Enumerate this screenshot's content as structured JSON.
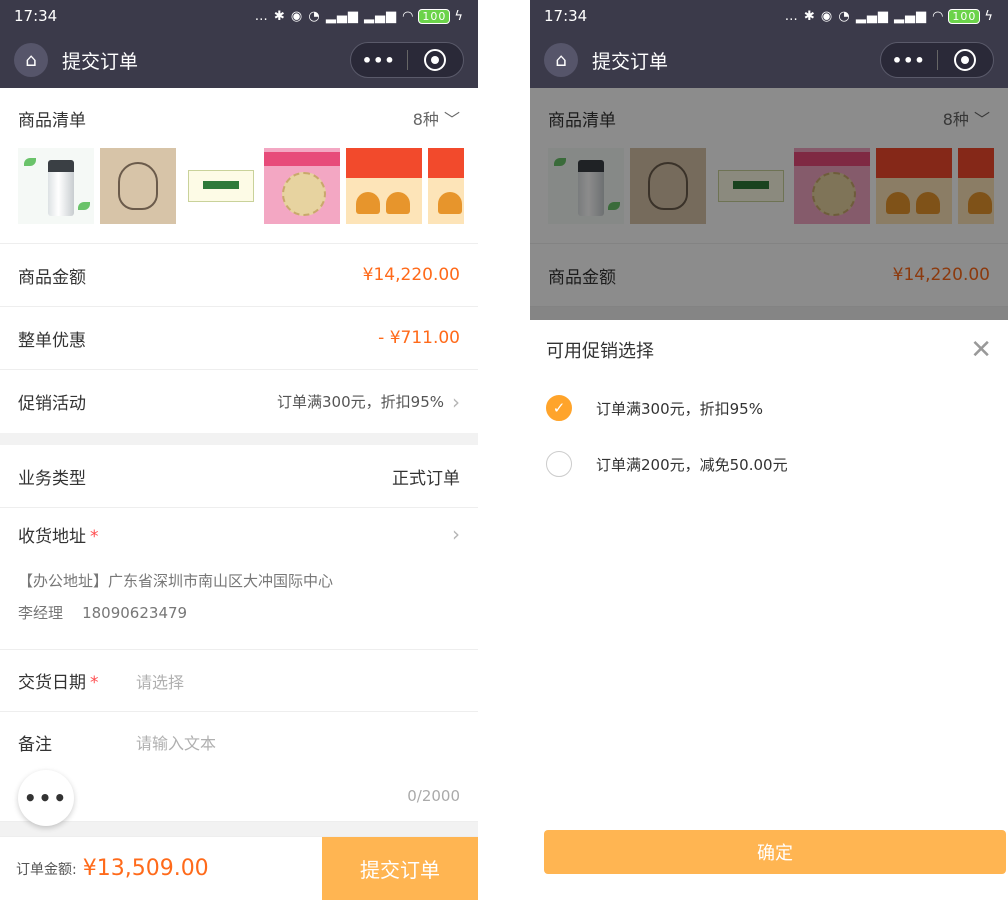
{
  "status": {
    "time": "17:34",
    "battery": "100"
  },
  "nav": {
    "title": "提交订单",
    "more": "•••"
  },
  "goods": {
    "label": "商品清单",
    "count": "8种"
  },
  "summary": {
    "amount_label": "商品金额",
    "amount_value": "¥14,220.00",
    "discount_label": "整单优惠",
    "discount_value": "- ¥711.00",
    "promo_label": "促销活动",
    "promo_value": "订单满300元，折扣95%"
  },
  "order": {
    "biz_type_label": "业务类型",
    "biz_type_value": "正式订单",
    "address_label": "收货地址",
    "address_line": "【办公地址】广东省深圳市南山区大冲国际中心",
    "contact_name": "李经理",
    "contact_phone": "18090623479",
    "delivery_label": "交货日期",
    "delivery_placeholder": "请选择",
    "note_label": "备注",
    "note_placeholder": "请输入文本",
    "note_counter": "0/2000",
    "required_mark": "*"
  },
  "bottom": {
    "total_label": "订单金额:",
    "total_value": "¥13,509.00",
    "submit": "提交订单"
  },
  "promo_sheet": {
    "title": "可用促销选择",
    "options": [
      {
        "label": "订单满300元，折扣95%",
        "selected": true
      },
      {
        "label": "订单满200元，减免50.00元",
        "selected": false
      }
    ],
    "confirm": "确定"
  },
  "colors": {
    "accent": "#ff6a1a",
    "button": "#ffb552",
    "check": "#ffa42b",
    "navbar": "#3b3a4a"
  }
}
